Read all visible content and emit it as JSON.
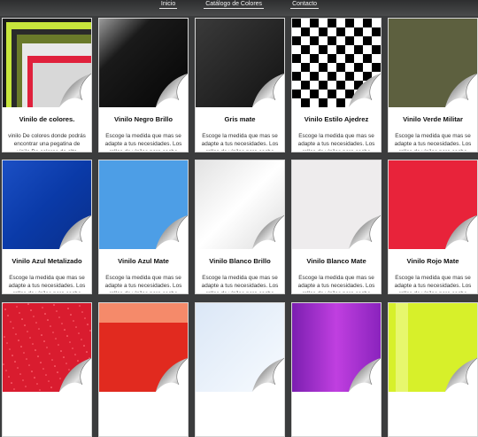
{
  "nav": {
    "items": [
      {
        "label": "Inicio"
      },
      {
        "label": "Catálogo de Colores"
      },
      {
        "label": "Contacto"
      }
    ]
  },
  "products": [
    {
      "title": "Vinilo de colores.",
      "desc": "vinilo De colores donde podrás encontrar una pegatina de vinilo De colores de alta",
      "swatch": "multicolor"
    },
    {
      "title": "Vinilo Negro Brillo",
      "desc": "Escoge la medida que mas se adapte a tus necesidades. Los rollos de vinilos para coche",
      "swatch": "black-gloss"
    },
    {
      "title": "Gris mate",
      "desc": "Escoge la medida que mas se adapte a tus necesidades. Los rollos de vinilos para coche",
      "swatch": "grey-matte"
    },
    {
      "title": "Vinilo Estilo Ajedrez",
      "desc": "Escoge la medida que mas se adapte a tus necesidades. Los rollos de vinilos para coche",
      "swatch": "checker"
    },
    {
      "title": "Vinilo Verde Militar",
      "desc": "Escoge la medida que mas se adapte a tus necesidades. Los rollos de vinilos para coche",
      "swatch": "military-green"
    },
    {
      "title": "Vinilo Azul Metalizado",
      "desc": "Escoge la medida que mas se adapte a tus necesidades. Los rollos de vinilos para coche",
      "swatch": "metallic-blue"
    },
    {
      "title": "Vinilo Azul Mate",
      "desc": "Escoge la medida que mas se adapte a tus necesidades. Los rollos de vinilos para coche",
      "swatch": "matte-blue"
    },
    {
      "title": "Vinilo Blanco Brillo",
      "desc": "Escoge la medida que mas se adapte a tus necesidades. Los rollos de vinilos para coche",
      "swatch": "white-gloss"
    },
    {
      "title": "Vinilo Blanco Mate",
      "desc": "Escoge la medida que mas se adapte a tus necesidades. Los rollos de vinilos para coche",
      "swatch": "white-matte"
    },
    {
      "title": "Vinilo Rojo Mate",
      "desc": "Escoge la medida que mas se adapte a tus necesidades. Los rollos de vinilos para coche",
      "swatch": "red-matte"
    },
    {
      "title": "",
      "desc": "",
      "swatch": "red-glitter"
    },
    {
      "title": "",
      "desc": "",
      "swatch": "orange-red"
    },
    {
      "title": "",
      "desc": "",
      "swatch": "pale-blue"
    },
    {
      "title": "",
      "desc": "",
      "swatch": "purple"
    },
    {
      "title": "",
      "desc": "",
      "swatch": "lime"
    }
  ],
  "colors": {
    "background": "#3b3c3d",
    "card": "#ffffff"
  }
}
